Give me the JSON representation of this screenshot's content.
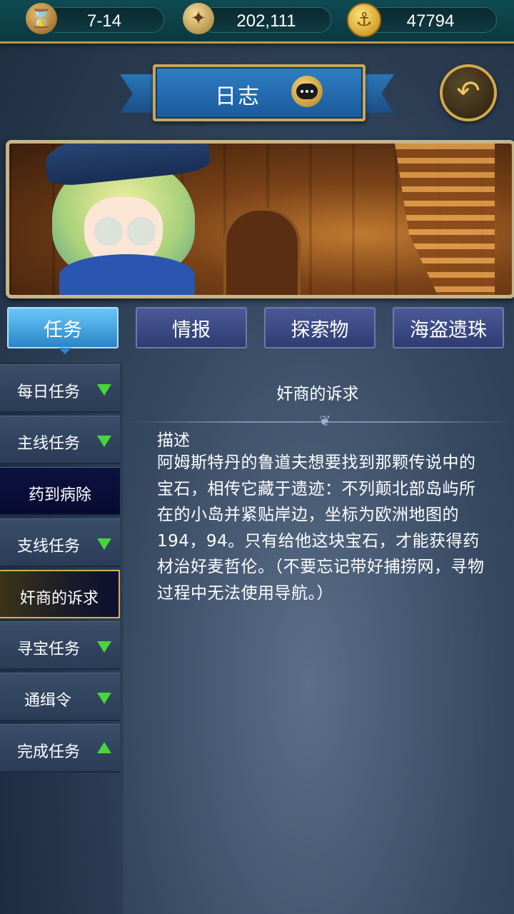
{
  "resources": {
    "time": "7-14",
    "exploration": "202,111",
    "gold": "47794"
  },
  "header": {
    "title": "日志"
  },
  "tabs": [
    {
      "label": "任务",
      "active": true
    },
    {
      "label": "情报",
      "active": false
    },
    {
      "label": "探索物",
      "active": false
    },
    {
      "label": "海盗遗珠",
      "active": false
    }
  ],
  "sidebar": {
    "items": [
      {
        "label": "每日任务",
        "arrow": "down"
      },
      {
        "label": "主线任务",
        "arrow": "down"
      },
      {
        "label": "药到病除",
        "type": "sub"
      },
      {
        "label": "支线任务",
        "arrow": "down"
      },
      {
        "label": "奸商的诉求",
        "type": "selected"
      },
      {
        "label": "寻宝任务",
        "arrow": "down"
      },
      {
        "label": "通缉令",
        "arrow": "down"
      },
      {
        "label": "完成任务",
        "arrow": "up"
      }
    ]
  },
  "quest": {
    "title": "奸商的诉求",
    "heading": "描述",
    "description": "阿姆斯特丹的鲁道夫想要找到那颗传说中的宝石，相传它藏于遗迹：不列颠北部岛屿所在的小岛并紧贴岸边，坐标为欧洲地图的194，94。只有给他这块宝石，才能获得药材治好麦哲伦。（不要忘记带好捕捞网，寻物过程中无法使用导航。）"
  },
  "colors": {
    "accent_gold": "#c9a65a",
    "active_tab": "#2a86c8",
    "arrow_green": "#4ad43a"
  }
}
